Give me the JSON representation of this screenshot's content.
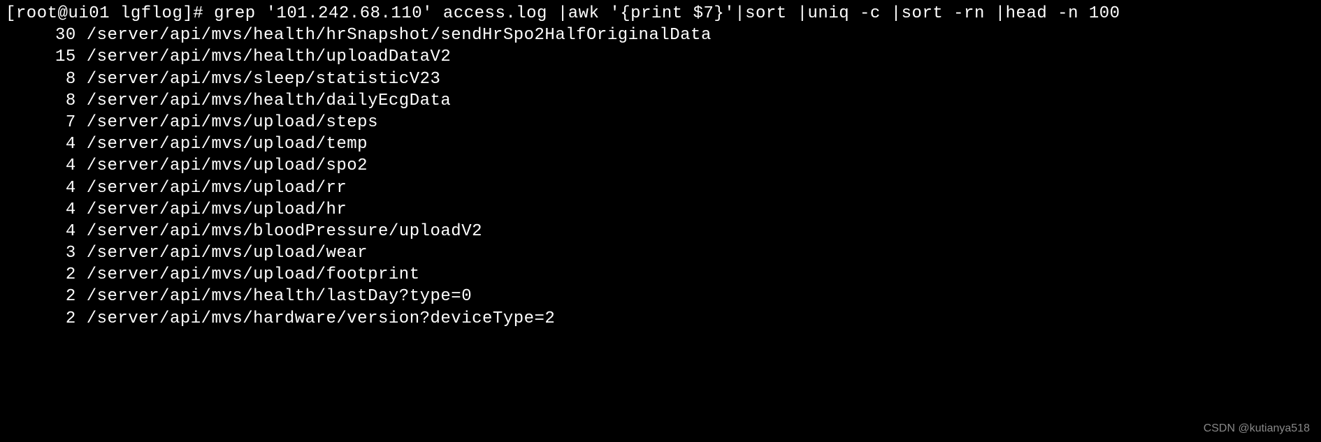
{
  "prompt": {
    "user": "root",
    "host": "ui01",
    "directory": "lgflog",
    "symbol": "#",
    "command": "grep '101.242.68.110' access.log |awk '{print $7}'|sort |uniq -c |sort -rn |head -n 100"
  },
  "output": [
    {
      "count": "30",
      "path": "/server/api/mvs/health/hrSnapshot/sendHrSpo2HalfOriginalData"
    },
    {
      "count": "15",
      "path": "/server/api/mvs/health/uploadDataV2"
    },
    {
      "count": "8",
      "path": "/server/api/mvs/sleep/statisticV23"
    },
    {
      "count": "8",
      "path": "/server/api/mvs/health/dailyEcgData"
    },
    {
      "count": "7",
      "path": "/server/api/mvs/upload/steps"
    },
    {
      "count": "4",
      "path": "/server/api/mvs/upload/temp"
    },
    {
      "count": "4",
      "path": "/server/api/mvs/upload/spo2"
    },
    {
      "count": "4",
      "path": "/server/api/mvs/upload/rr"
    },
    {
      "count": "4",
      "path": "/server/api/mvs/upload/hr"
    },
    {
      "count": "4",
      "path": "/server/api/mvs/bloodPressure/uploadV2"
    },
    {
      "count": "3",
      "path": "/server/api/mvs/upload/wear"
    },
    {
      "count": "2",
      "path": "/server/api/mvs/upload/footprint"
    },
    {
      "count": "2",
      "path": "/server/api/mvs/health/lastDay?type=0"
    },
    {
      "count": "2",
      "path": "/server/api/mvs/hardware/version?deviceType=2"
    }
  ],
  "watermark": "CSDN @kutianya518"
}
